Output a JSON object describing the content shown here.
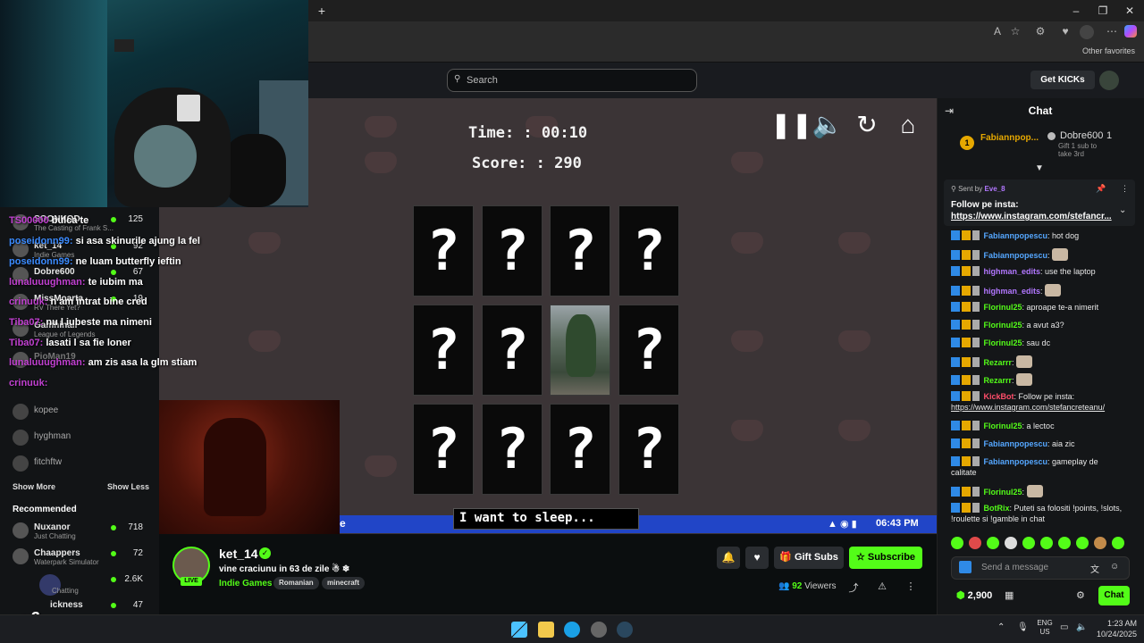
{
  "browser": {
    "new_tab_icon": "plus-icon",
    "favorites_label": "Other favorites"
  },
  "header": {
    "search_placeholder": "Search",
    "get_kicks_label": "Get KICKs"
  },
  "overlay_chat": [
    {
      "user": "TS00000",
      "text": "bulca te"
    },
    {
      "user": "poseidonn99:",
      "text": "si asa skinurile ajung la fel"
    },
    {
      "user": "poseidonn99:",
      "text": "ne luam butterfly ieftin"
    },
    {
      "user": "lunaluuughman:",
      "text": "te iubim ma"
    },
    {
      "user": "crinuuk:",
      "text": "n am intrat bine cred"
    },
    {
      "user": "Tiba07:",
      "text": "nu l iubeste ma nimeni"
    },
    {
      "user": "Tiba07:",
      "text": "lasati l sa fie loner"
    },
    {
      "user": "lunaluuughman:",
      "text": "am zis asa la glm stiam"
    },
    {
      "user": "crinuuk:",
      "text": ""
    }
  ],
  "sidebar": {
    "following": [
      {
        "name": "SOONKOD",
        "sub": "The Casting of Frank S...",
        "count": "125"
      },
      {
        "name": "ket_14",
        "sub": "Indie Games",
        "count": "92"
      },
      {
        "name": "Dobre600",
        "sub": "",
        "count": "67"
      },
      {
        "name": "MissMoarta",
        "sub": "RV There Yet?",
        "count": "19"
      },
      {
        "name": "Gamhinali",
        "sub": "League of Legends",
        "count": ""
      },
      {
        "name": "PioMan19",
        "sub": "",
        "count": ""
      }
    ],
    "offline": [
      "kopee",
      "hyghman",
      "fitchftw"
    ],
    "show_more": "Show More",
    "show_less": "Show Less",
    "recommended_title": "Recommended",
    "recommended": [
      {
        "name": "Nuxanor",
        "sub": "Just Chatting",
        "count": "718"
      },
      {
        "name": "Chaappers",
        "sub": "Waterpark Simulator",
        "count": "72"
      },
      {
        "name": "",
        "sub": "Chatting",
        "count": "2.6K"
      },
      {
        "name": "ickness",
        "sub": "",
        "count": "47"
      }
    ],
    "multiplier": "x2"
  },
  "game": {
    "time_label": "Time:  :  00:10",
    "score_label": "Score:  :  290",
    "card_symbol": "?",
    "subtitle": "I want to sleep...",
    "strip_time": "06:43 PM",
    "strip_letter": "e"
  },
  "stream": {
    "streamer": "ket_14",
    "title": "vine craciunu in 63 de zile ☃ ❄",
    "category": "Indie Games",
    "tags": [
      "Romanian",
      "minecraft"
    ],
    "live": "LIVE",
    "gift_subs": "Gift Subs",
    "subscribe": "Subscribe",
    "viewers_count": "92",
    "viewers_label": "Viewers"
  },
  "chat": {
    "title": "Chat",
    "leader1_rank": "1",
    "leader1_name": "Fabiannpop...",
    "leader2_name": "Dobre600",
    "leader2_count": "1",
    "gift_hint": "Gift 1 sub to take 3rd",
    "pinned_sent_by": "Sent by",
    "pinned_user": "Eve_8",
    "pinned_line1": "Follow pe insta:",
    "pinned_line2": "https://www.instagram.com/stefancr...",
    "messages": [
      {
        "user": "Fabiannpopescu",
        "color": "blue",
        "text": "hot dog"
      },
      {
        "user": "Fabiannpopescu",
        "color": "blue",
        "text": "",
        "emote": true
      },
      {
        "user": "highman_edits",
        "color": "purple",
        "text": "use the laptop"
      },
      {
        "user": "highman_edits",
        "color": "purple",
        "text": "",
        "emote": true
      },
      {
        "user": "Florinul25",
        "color": "green",
        "text": "aproape te-a nimerit"
      },
      {
        "user": "Florinul25",
        "color": "green",
        "text": "a avut a3?"
      },
      {
        "user": "Florinul25",
        "color": "green",
        "text": "sau dc"
      },
      {
        "user": "Rezarrr",
        "color": "green",
        "text": "",
        "emote": true
      },
      {
        "user": "Rezarrr",
        "color": "green",
        "text": "",
        "emote": true
      },
      {
        "user": "KickBot",
        "color": "red",
        "text": "Follow pe insta:"
      },
      {
        "user": "",
        "color": "",
        "text": "https://www.instagram.com/stefancreteanu/"
      },
      {
        "user": "Florinul25",
        "color": "green",
        "text": "a lectoc"
      },
      {
        "user": "Fabiannpopescu",
        "color": "blue",
        "text": "aia zic"
      },
      {
        "user": "Fabiannpopescu",
        "color": "blue",
        "text": "gameplay de"
      },
      {
        "user": "",
        "color": "",
        "text": "calitate"
      },
      {
        "user": "Florinul25",
        "color": "green",
        "text": "",
        "emote": true
      },
      {
        "user": "BotRix",
        "color": "green",
        "text": "Puteti sa folositi !points, !slots,"
      },
      {
        "user": "",
        "color": "",
        "text": "!roulette si !gamble in chat"
      }
    ],
    "send_placeholder": "Send a message",
    "points": "2,900",
    "chat_button": "Chat"
  },
  "taskbar": {
    "lang1": "ENG",
    "lang2": "US",
    "time": "1:23 AM",
    "date": "10/24/2025"
  }
}
